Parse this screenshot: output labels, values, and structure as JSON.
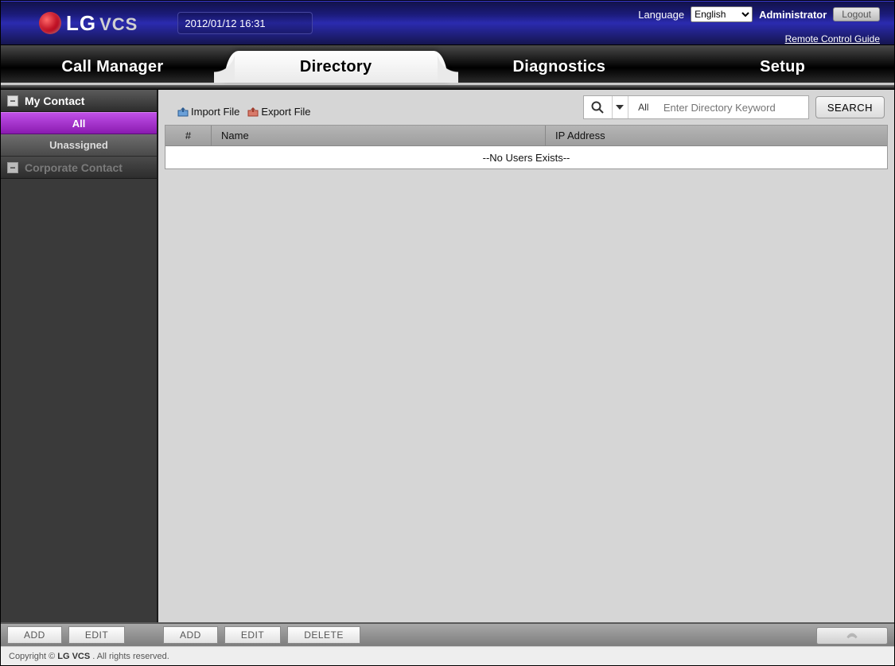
{
  "header": {
    "brand_lg": "LG",
    "brand_vcs": "VCS",
    "datetime": "2012/01/12 16:31",
    "language_label": "Language",
    "language_value": "English",
    "admin_label": "Administrator",
    "logout_label": "Logout",
    "remote_guide": "Remote Control Guide"
  },
  "tabs": {
    "call_manager": "Call Manager",
    "directory": "Directory",
    "diagnostics": "Diagnostics",
    "setup": "Setup"
  },
  "sidebar": {
    "my_contact": "My Contact",
    "all": "All",
    "unassigned": "Unassigned",
    "corporate_contact": "Corporate Contact"
  },
  "toolbar": {
    "import_file": "Import File",
    "export_file": "Export File"
  },
  "search": {
    "scope": "All",
    "placeholder": "Enter Directory Keyword",
    "button": "SEARCH"
  },
  "table": {
    "col_num": "#",
    "col_name": "Name",
    "col_ip": "IP Address",
    "empty": "--No Users Exists--"
  },
  "bottom_left": {
    "add": "ADD",
    "edit": "EDIT"
  },
  "bottom_right": {
    "add": "ADD",
    "edit": "EDIT",
    "delete": "DELETE"
  },
  "footer": {
    "prefix": "Copyright ©",
    "brand": "LG VCS",
    "suffix": ". All rights reserved."
  }
}
